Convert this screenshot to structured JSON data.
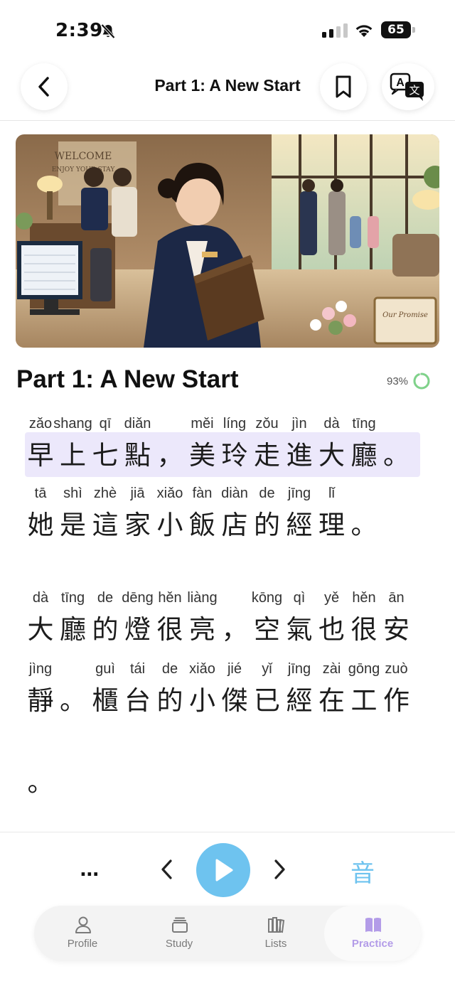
{
  "status_bar": {
    "time": "2:39",
    "battery": "65"
  },
  "nav": {
    "title": "Part 1: A New Start"
  },
  "chapter": {
    "title": "Part 1: A New Start",
    "progress": "93%",
    "progress_value": 0.93
  },
  "hero_signs": {
    "welcome": "WELCOME",
    "enjoy": "ENJOY YOUR STAY",
    "promise": "Our Promise"
  },
  "lines": [
    {
      "highlight": true,
      "chars": [
        {
          "h": "早",
          "p": "zǎo"
        },
        {
          "h": "上",
          "p": "shang"
        },
        {
          "h": "七",
          "p": "qī"
        },
        {
          "h": "點",
          "p": "diǎn"
        },
        {
          "h": "，",
          "p": ""
        },
        {
          "h": "美",
          "p": "měi"
        },
        {
          "h": "玲",
          "p": "líng"
        },
        {
          "h": "走",
          "p": "zǒu"
        },
        {
          "h": "進",
          "p": "jìn"
        },
        {
          "h": "大",
          "p": "dà"
        },
        {
          "h": "廳",
          "p": "tīng"
        },
        {
          "h": "。",
          "p": ""
        }
      ]
    },
    {
      "highlight": false,
      "chars": [
        {
          "h": "她",
          "p": "tā"
        },
        {
          "h": "是",
          "p": "shì"
        },
        {
          "h": "這",
          "p": "zhè"
        },
        {
          "h": "家",
          "p": "jiā"
        },
        {
          "h": "小",
          "p": "xiǎo"
        },
        {
          "h": "飯",
          "p": "fàn"
        },
        {
          "h": "店",
          "p": "diàn"
        },
        {
          "h": "的",
          "p": "de"
        },
        {
          "h": "經",
          "p": "jīng"
        },
        {
          "h": "理",
          "p": "lǐ"
        },
        {
          "h": "。",
          "p": ""
        }
      ]
    },
    {
      "highlight": false,
      "chars": [
        {
          "h": "大",
          "p": "dà"
        },
        {
          "h": "廳",
          "p": "tīng"
        },
        {
          "h": "的",
          "p": "de"
        },
        {
          "h": "燈",
          "p": "dēng"
        },
        {
          "h": "很",
          "p": "hěn"
        },
        {
          "h": "亮",
          "p": "liàng"
        },
        {
          "h": "，",
          "p": ""
        },
        {
          "h": "空",
          "p": "kōng"
        },
        {
          "h": "氣",
          "p": "qì"
        },
        {
          "h": "也",
          "p": "yě"
        },
        {
          "h": "很",
          "p": "hěn"
        },
        {
          "h": "安",
          "p": "ān"
        }
      ]
    },
    {
      "highlight": false,
      "chars": [
        {
          "h": "靜",
          "p": "jìng"
        },
        {
          "h": "。",
          "p": ""
        },
        {
          "h": "櫃",
          "p": "guì"
        },
        {
          "h": "台",
          "p": "tái"
        },
        {
          "h": "的",
          "p": "de"
        },
        {
          "h": "小",
          "p": "xiǎo"
        },
        {
          "h": "傑",
          "p": "jié"
        },
        {
          "h": "已",
          "p": "yǐ"
        },
        {
          "h": "經",
          "p": "jīng"
        },
        {
          "h": "在",
          "p": "zài"
        },
        {
          "h": "工",
          "p": "gōng"
        },
        {
          "h": "作",
          "p": "zuò"
        }
      ]
    },
    {
      "highlight": false,
      "chars": [
        {
          "h": "。",
          "p": ""
        }
      ]
    }
  ],
  "controls": {
    "more": "...",
    "sound": "音"
  },
  "tabs": [
    {
      "label": "Profile",
      "icon": "person-icon",
      "active": false
    },
    {
      "label": "Study",
      "icon": "stack-icon",
      "active": false
    },
    {
      "label": "Lists",
      "icon": "books-icon",
      "active": false
    },
    {
      "label": "Practice",
      "icon": "open-book-icon",
      "active": true
    }
  ],
  "colors": {
    "accent_blue": "#6ec3ef",
    "practice_purple": "#b39ce8",
    "highlight": "#ece8fb",
    "progress_green": "#7fd28a"
  }
}
